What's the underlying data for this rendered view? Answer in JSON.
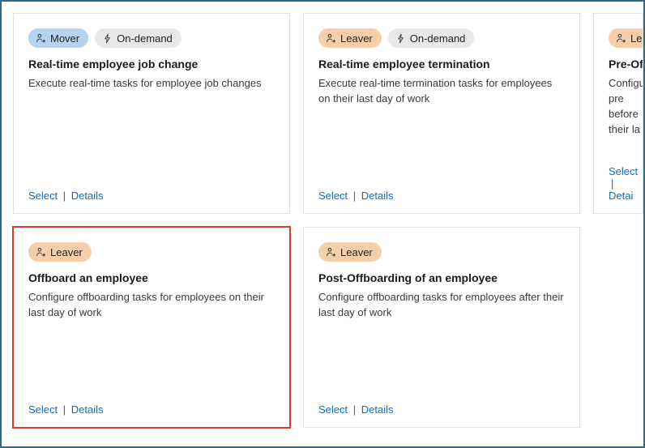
{
  "actions": {
    "select": "Select",
    "details": "Details",
    "partial_details": "Detai"
  },
  "tags": {
    "mover": "Mover",
    "leaver": "Leaver",
    "on_demand": "On-demand"
  },
  "cards": [
    {
      "tag_type": "mover",
      "on_demand": true,
      "title": "Real-time employee job change",
      "desc": "Execute real-time tasks for employee job changes",
      "highlighted": false,
      "partial": false
    },
    {
      "tag_type": "leaver",
      "on_demand": true,
      "title": "Real-time employee termination",
      "desc": "Execute real-time termination tasks for employees on their last day of work",
      "highlighted": false,
      "partial": false
    },
    {
      "tag_type": "leaver",
      "on_demand": false,
      "title": "Pre-Offboard",
      "desc": "Configure pre before their la",
      "highlighted": false,
      "partial": true
    },
    {
      "tag_type": "leaver",
      "on_demand": false,
      "title": "Offboard an employee",
      "desc": "Configure offboarding tasks for employees on their last day of work",
      "highlighted": true,
      "partial": false
    },
    {
      "tag_type": "leaver",
      "on_demand": false,
      "title": "Post-Offboarding of an employee",
      "desc": "Configure offboarding tasks for employees after their last day of work",
      "highlighted": false,
      "partial": false
    }
  ]
}
